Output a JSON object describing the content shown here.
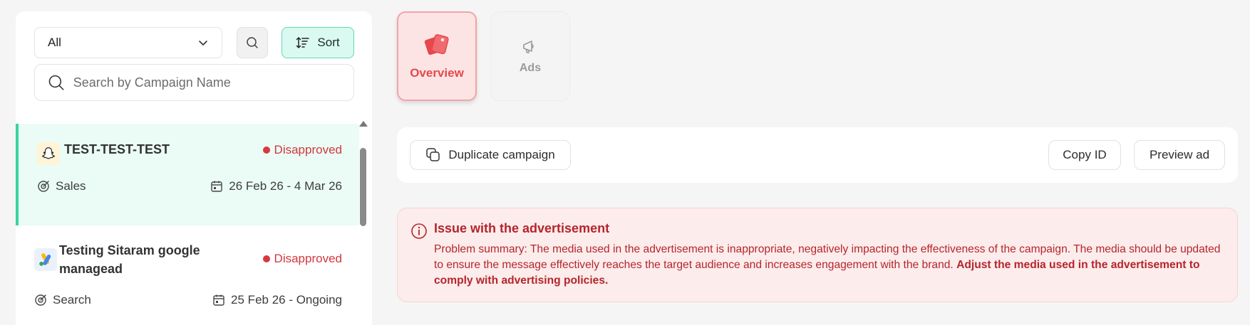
{
  "filter": {
    "selected": "All"
  },
  "sort": {
    "label": "Sort"
  },
  "search": {
    "placeholder": "Search by Campaign Name"
  },
  "campaigns": [
    {
      "name": "TEST-TEST-TEST",
      "status": "Disapproved",
      "objective": "Sales",
      "dates": "26 Feb 26 - 4 Mar 26",
      "platform_icon": "snapchat-icon",
      "selected": true
    },
    {
      "name": "Testing Sitaram google managead",
      "status": "Disapproved",
      "objective": "Search",
      "dates": "25 Feb 26 - Ongoing",
      "platform_icon": "google-ads-icon",
      "selected": false
    }
  ],
  "tabs": [
    {
      "label": "Overview",
      "icon": "overview-icon",
      "active": true
    },
    {
      "label": "Ads",
      "icon": "megaphone-icon",
      "active": false
    }
  ],
  "actions": {
    "duplicate": "Duplicate campaign",
    "copy_id": "Copy ID",
    "preview": "Preview ad"
  },
  "issue": {
    "title": "Issue with the advertisement",
    "summary": "Problem summary: The media used in the advertisement is inappropriate, negatively impacting the effectiveness of the campaign. The media should be updated to ensure the message effectively reaches the target audience and increases engagement with the brand.",
    "recommendation": "Adjust the media used in the advertisement to comply with advertising policies."
  },
  "colors": {
    "accent_green": "#36d4a2",
    "error_red": "#d0383e",
    "tab_active": "#e5484d"
  }
}
